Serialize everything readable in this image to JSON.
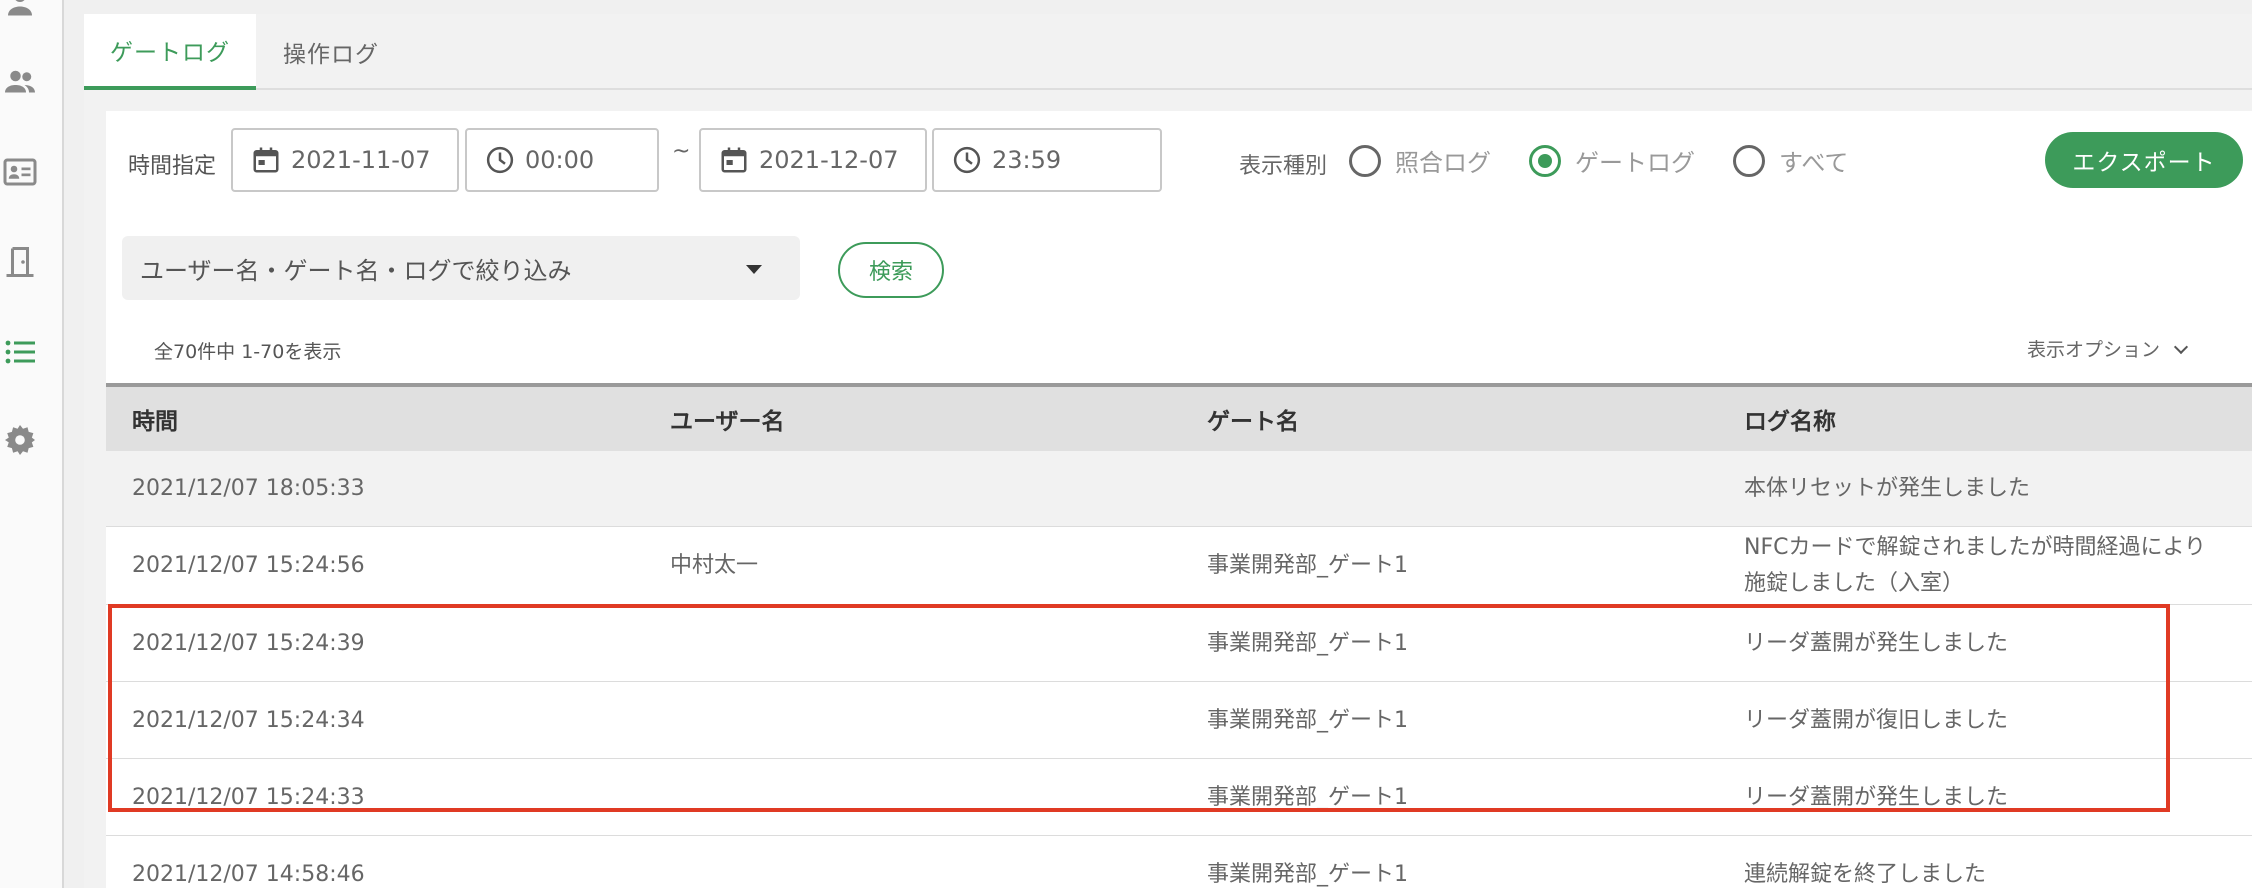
{
  "tabs": [
    {
      "label": "ゲートログ",
      "active": true
    },
    {
      "label": "操作ログ",
      "active": false
    }
  ],
  "filters": {
    "time_label": "時間指定",
    "start_date": "2021-11-07",
    "start_time": "00:00",
    "separator": "~",
    "end_date": "2021-12-07",
    "end_time": "23:59",
    "display_type_label": "表示種別",
    "display_types": [
      {
        "label": "照合ログ",
        "selected": false
      },
      {
        "label": "ゲートログ",
        "selected": true
      },
      {
        "label": "すべて",
        "selected": false
      }
    ],
    "export_label": "エクスポート",
    "filter_placeholder": "ユーザー名・ゲート名・ログで絞り込み",
    "search_label": "検索"
  },
  "result_count": "全70件中 1-70を表示",
  "display_options_label": "表示オプション",
  "table": {
    "headers": [
      "時間",
      "ユーザー名",
      "ゲート名",
      "ログ名称"
    ],
    "rows": [
      {
        "time": "2021/12/07 18:05:33",
        "user": "",
        "gate": "",
        "log": "本体リセットが発生しました"
      },
      {
        "time": "2021/12/07 15:24:56",
        "user": "中村太一",
        "gate": "事業開発部_ゲート1",
        "log": "NFCカードで解錠されましたが時間経過により\n施錠しました（入室）"
      },
      {
        "time": "2021/12/07 15:24:39",
        "user": "",
        "gate": "事業開発部_ゲート1",
        "log": "リーダ蓋開が発生しました"
      },
      {
        "time": "2021/12/07 15:24:34",
        "user": "",
        "gate": "事業開発部_ゲート1",
        "log": "リーダ蓋開が復旧しました"
      },
      {
        "time": "2021/12/07 15:24:33",
        "user": "",
        "gate": "事業開発部_ゲート1",
        "log": "リーダ蓋開が発生しました"
      },
      {
        "time": "2021/12/07 14:58:46",
        "user": "",
        "gate": "事業開発部_ゲート1",
        "log": "連続解錠を終了しました"
      }
    ]
  },
  "colors": {
    "accent": "#3d9b5a",
    "highlight_border": "#e03a24"
  },
  "sidebar_icons": [
    "person-icon",
    "people-icon",
    "id-card-icon",
    "door-icon",
    "list-icon",
    "gear-icon"
  ]
}
